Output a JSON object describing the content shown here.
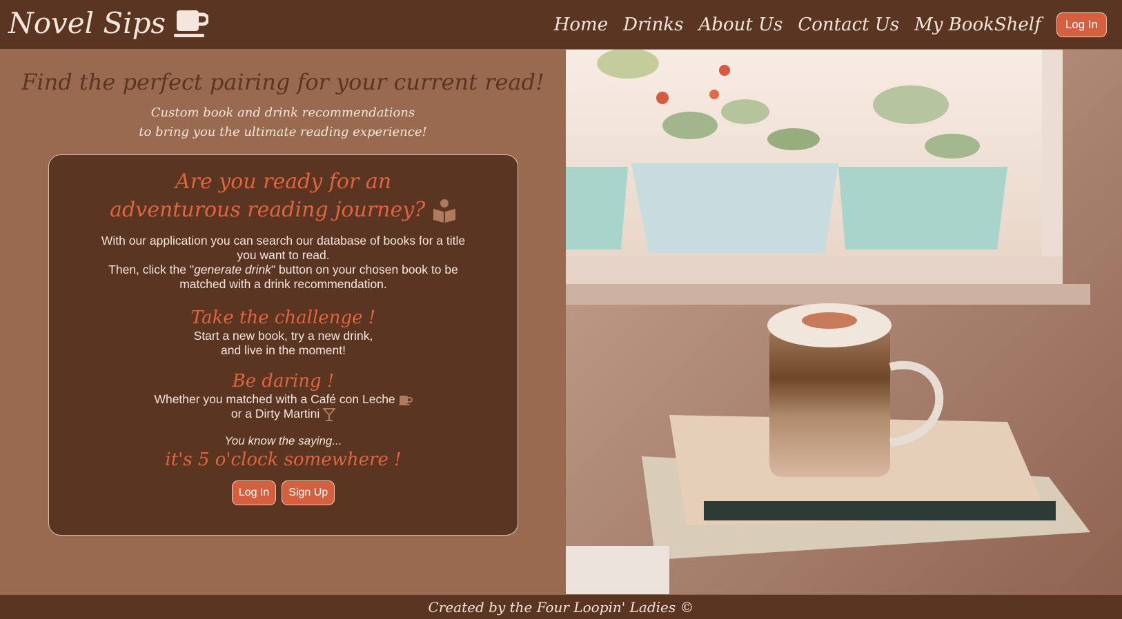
{
  "nav": {
    "brand": "Novel Sips",
    "links": [
      "Home",
      "Drinks",
      "About Us",
      "Contact Us",
      "My BookShelf"
    ],
    "login_label": "Log In"
  },
  "hero": {
    "headline": "Find the perfect pairing for your current read!",
    "subline_1": "Custom book and drink recommendations",
    "subline_2": "to bring you the ultimate reading experience!"
  },
  "card": {
    "title_1": "Are you ready for an",
    "title_2": "adventurous reading journey?",
    "body_1": "With our application you can search our database of books for a title you want to read.",
    "body_2_pre": "Then, click the \"",
    "body_2_em": "generate drink",
    "body_2_post": "\" button on your chosen book to be matched with a drink recommendation.",
    "challenge_title": "Take the challenge !",
    "challenge_1": "Start a new book, try a new drink,",
    "challenge_2": "and live in the moment!",
    "daring_title": "Be daring !",
    "daring_1": "Whether you matched with a Café con Leche",
    "daring_2": "or a Dirty Martini",
    "saying": "You know the saying...",
    "oclock": "it's 5 o'clock somewhere !",
    "login_label": "Log In",
    "signup_label": "Sign Up"
  },
  "footer": {
    "text": "Created by the Four Loopin' Ladies ©"
  },
  "icons": {
    "brand": "coffee-cup-icon",
    "title": "reading-person-icon",
    "cafe": "coffee-cup-icon",
    "martini": "martini-glass-icon"
  },
  "colors": {
    "nav_bg": "#5a3522",
    "page_bg": "#9a6a50",
    "accent": "#e0643e",
    "button": "#d65f3f",
    "text_light": "#f3e6dc"
  }
}
